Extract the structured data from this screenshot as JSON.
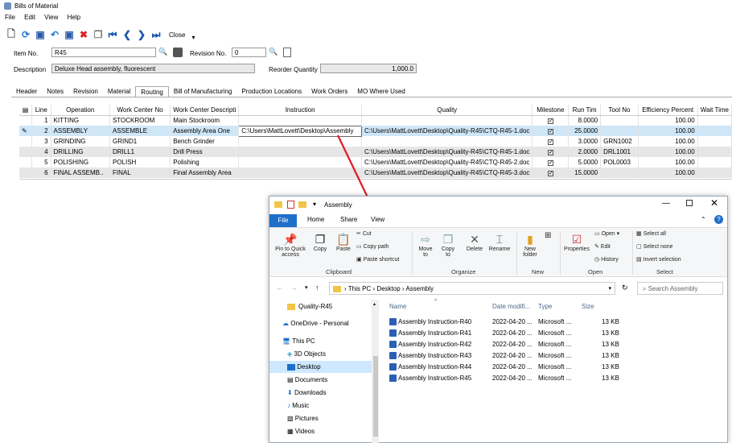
{
  "app": {
    "title": "Bills of Material",
    "menu": [
      "File",
      "Edit",
      "View",
      "Help"
    ],
    "close_label": "Close"
  },
  "header": {
    "item_no_label": "Item No.",
    "item_no": "R45",
    "revision_label": "Revision No.",
    "revision": "0",
    "description_label": "Description",
    "description": "Deluxe Head assembly, fluorescent",
    "reorder_label": "Reorder Quantity",
    "reorder": "1,000.0"
  },
  "tabs": [
    "Header",
    "Notes",
    "Revision",
    "Material",
    "Routing",
    "Bill of Manufacturing",
    "Production Locations",
    "Work Orders",
    "MO Where Used"
  ],
  "grid": {
    "columns": [
      "Line",
      "Operation",
      "Work Center No",
      "Work Center Descripti",
      "Instruction",
      "Quality",
      "Milestone",
      "Run Tim",
      "Tool No",
      "Efficiency Percent",
      "Wait Time"
    ],
    "rows": [
      {
        "line": "1",
        "op": "KITTING",
        "wc": "STOCKROOM",
        "wcd": "Main Stockroom",
        "inst": "",
        "qual": "",
        "run": "8.0000",
        "tool": "",
        "eff": "100.00"
      },
      {
        "line": "2",
        "op": "ASSEMBLY",
        "wc": "ASSEMBLE",
        "wcd": "Assembly Area One",
        "inst": "C:\\Users\\MattLovett\\Desktop\\Assembly",
        "qual": "C:\\Users\\MattLovett\\Desktop\\Quality-R45\\CTQ-R45-1.doc",
        "run": "25.0000",
        "tool": "",
        "eff": "100.00"
      },
      {
        "line": "3",
        "op": "GRINDING",
        "wc": "GRIND1",
        "wcd": "Bench Grinder",
        "inst": "",
        "qual": "",
        "run": "3.0000",
        "tool": "GRN1002",
        "eff": "100.00"
      },
      {
        "line": "4",
        "op": "DRILLING",
        "wc": "DRILL1",
        "wcd": "Drill Press",
        "inst": "",
        "qual": "C:\\Users\\MattLovett\\Desktop\\Quality-R45\\CTQ-R45-1.doc",
        "run": "2.0000",
        "tool": "DRL1001",
        "eff": "100.00"
      },
      {
        "line": "5",
        "op": "POLISHING",
        "wc": "POLISH",
        "wcd": "Polishing",
        "inst": "",
        "qual": "C:\\Users\\MattLovett\\Desktop\\Quality-R45\\CTQ-R45-2.doc",
        "run": "5.0000",
        "tool": "POL0003",
        "eff": "100.00"
      },
      {
        "line": "6",
        "op": "FINAL ASSEMB..",
        "wc": "FINAL",
        "wcd": "Final Assembly Area",
        "inst": "",
        "qual": "C:\\Users\\MattLovett\\Desktop\\Quality-R45\\CTQ-R45-3.doc",
        "run": "15.0000",
        "tool": "",
        "eff": "100.00"
      }
    ]
  },
  "explorer": {
    "title": "Assembly",
    "ribbon_tabs": [
      "File",
      "Home",
      "Share",
      "View"
    ],
    "ribbon": {
      "clipboard": [
        "Pin to Quick access",
        "Copy",
        "Paste",
        "Cut",
        "Copy path",
        "Paste shortcut"
      ],
      "organize": [
        "Move to",
        "Copy to",
        "Delete",
        "Rename"
      ],
      "new": [
        "New folder"
      ],
      "open": [
        "Properties",
        "Open",
        "Edit",
        "History"
      ],
      "select": [
        "Select all",
        "Select none",
        "Invert selection"
      ],
      "groups": [
        "Clipboard",
        "Organize",
        "New",
        "Open",
        "Select"
      ]
    },
    "path": [
      "This PC",
      "Desktop",
      "Assembly"
    ],
    "search_placeholder": "Search Assembly",
    "nav": [
      "Quality-R45",
      "OneDrive - Personal",
      "This PC",
      "3D Objects",
      "Desktop",
      "Documents",
      "Downloads",
      "Music",
      "Pictures",
      "Videos"
    ],
    "file_headers": [
      "Name",
      "Date modifi...",
      "Type",
      "Size"
    ],
    "files": [
      {
        "name": "Assembly Instruction-R40",
        "date": "2022-04-20 ...",
        "type": "Microsoft ...",
        "size": "13 KB"
      },
      {
        "name": "Assembly Instruction-R41",
        "date": "2022-04-20 ...",
        "type": "Microsoft ...",
        "size": "13 KB"
      },
      {
        "name": "Assembly Instruction-R42",
        "date": "2022-04-20 ...",
        "type": "Microsoft ...",
        "size": "13 KB"
      },
      {
        "name": "Assembly Instruction-R43",
        "date": "2022-04-20 ...",
        "type": "Microsoft ...",
        "size": "13 KB"
      },
      {
        "name": "Assembly Instruction-R44",
        "date": "2022-04-20 ...",
        "type": "Microsoft ...",
        "size": "13 KB"
      },
      {
        "name": "Assembly Instruction-R45",
        "date": "2022-04-20 ...",
        "type": "Microsoft ...",
        "size": "13 KB"
      }
    ]
  }
}
